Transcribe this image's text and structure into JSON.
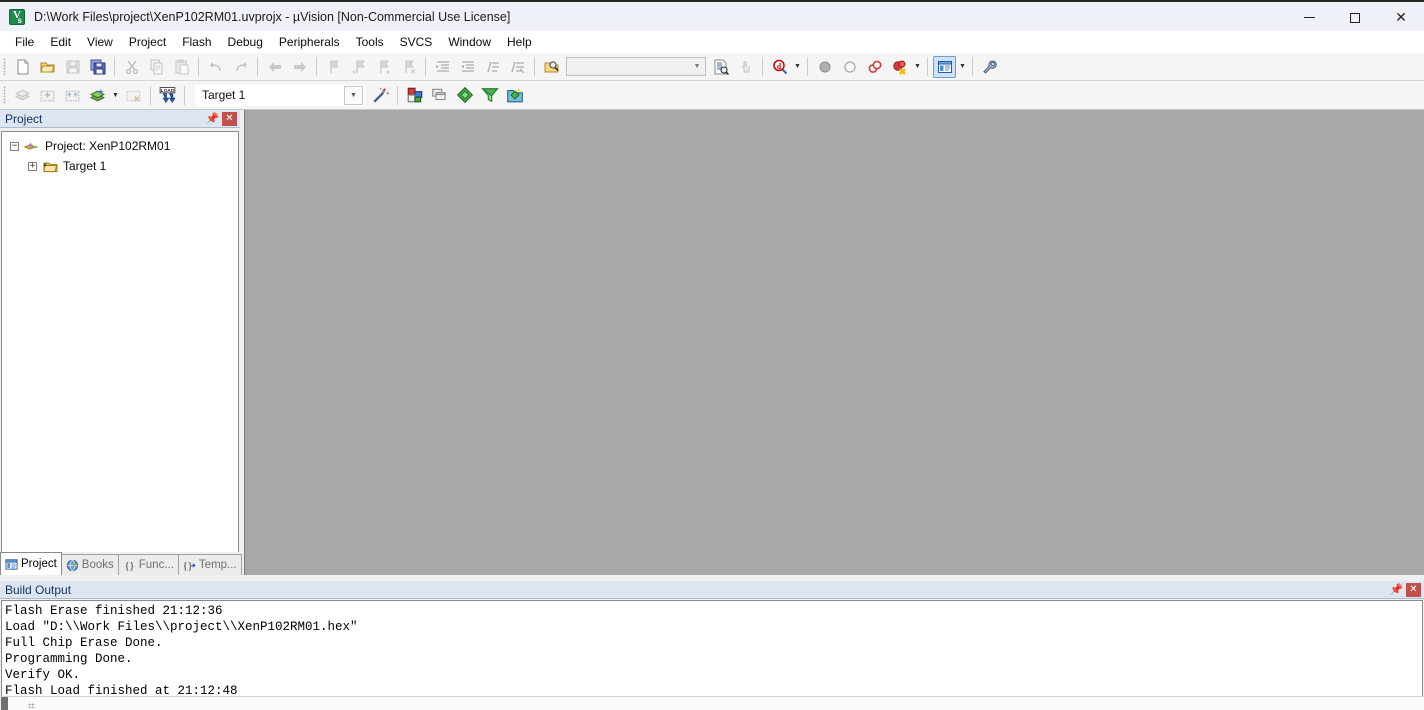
{
  "window": {
    "title": "D:\\Work Files\\project\\XenP102RM01.uvprojx - µVision  [Non-Commercial Use License]",
    "app_icon": "uvision-icon",
    "controls": {
      "minimize": "minimize-icon",
      "maximize": "maximize-icon",
      "close": "close-icon"
    }
  },
  "menubar": {
    "items": [
      {
        "label": "File"
      },
      {
        "label": "Edit"
      },
      {
        "label": "View"
      },
      {
        "label": "Project"
      },
      {
        "label": "Flash"
      },
      {
        "label": "Debug"
      },
      {
        "label": "Peripherals"
      },
      {
        "label": "Tools"
      },
      {
        "label": "SVCS"
      },
      {
        "label": "Window"
      },
      {
        "label": "Help"
      }
    ]
  },
  "toolbar_file": {
    "buttons": [
      {
        "name": "new-file-button",
        "icon": "new-file-icon",
        "enabled": true
      },
      {
        "name": "open-file-button",
        "icon": "open-folder-icon",
        "enabled": true
      },
      {
        "name": "save-button",
        "icon": "floppy-save-icon",
        "enabled": false
      },
      {
        "name": "save-all-button",
        "icon": "save-all-icon",
        "enabled": true
      },
      {
        "name": "cut-button",
        "icon": "scissors-icon",
        "enabled": false
      },
      {
        "name": "copy-button",
        "icon": "copy-icon",
        "enabled": false
      },
      {
        "name": "paste-button",
        "icon": "paste-icon",
        "enabled": false
      },
      {
        "name": "undo-button",
        "icon": "undo-arrow-icon",
        "enabled": false
      },
      {
        "name": "redo-button",
        "icon": "redo-arrow-icon",
        "enabled": false
      },
      {
        "name": "navigate-back-button",
        "icon": "arrow-left-icon",
        "enabled": false
      },
      {
        "name": "navigate-forward-button",
        "icon": "arrow-right-icon",
        "enabled": false
      },
      {
        "name": "toggle-bookmark-button",
        "icon": "bookmark-icon",
        "enabled": false
      },
      {
        "name": "previous-bookmark-button",
        "icon": "bookmark-prev-icon",
        "enabled": false
      },
      {
        "name": "next-bookmark-button",
        "icon": "bookmark-next-icon",
        "enabled": false
      },
      {
        "name": "clear-bookmarks-button",
        "icon": "bookmark-clear-icon",
        "enabled": false
      },
      {
        "name": "indent-button",
        "icon": "indent-right-icon",
        "enabled": false
      },
      {
        "name": "outdent-button",
        "icon": "indent-left-icon",
        "enabled": false
      },
      {
        "name": "comment-button",
        "icon": "comment-lines-icon",
        "enabled": false
      },
      {
        "name": "uncomment-button",
        "icon": "uncomment-lines-icon",
        "enabled": false
      },
      {
        "name": "find-in-files-button",
        "icon": "find-in-files-icon",
        "enabled": true
      },
      {
        "name": "bookmark-list-button",
        "icon": "document-search-icon",
        "enabled": true
      },
      {
        "name": "jump-back-button",
        "icon": "hand-pointer-icon",
        "enabled": false
      },
      {
        "name": "insert-debug-button",
        "icon": "red-d-magnifier-icon",
        "enabled": true
      },
      {
        "name": "insert-breakpoint-button",
        "icon": "grey-filled-circle-icon",
        "enabled": false
      },
      {
        "name": "remove-breakpoint-button",
        "icon": "grey-hollow-circle-icon",
        "enabled": false
      },
      {
        "name": "disable-all-breakpoints-button",
        "icon": "red-rings-icon",
        "enabled": true
      },
      {
        "name": "kill-all-breakpoints-button",
        "icon": "red-circle-x-icon",
        "enabled": true
      },
      {
        "name": "window-list-button",
        "icon": "window-panel-icon",
        "enabled": true,
        "active": true
      },
      {
        "name": "configuration-button",
        "icon": "wrench-icon",
        "enabled": true
      }
    ],
    "search": {
      "value": "",
      "placeholder": ""
    }
  },
  "toolbar_build": {
    "buttons": [
      {
        "name": "translate-file-button",
        "icon": "translate-stack-icon",
        "enabled": false
      },
      {
        "name": "build-target-button",
        "icon": "build-target-icon",
        "enabled": false
      },
      {
        "name": "rebuild-all-button",
        "icon": "rebuild-all-icon",
        "enabled": false
      },
      {
        "name": "batch-build-button",
        "icon": "batch-build-icon",
        "enabled": true
      },
      {
        "name": "stop-build-button",
        "icon": "stop-build-icon",
        "enabled": false
      },
      {
        "name": "download-button",
        "icon": "load-download-icon",
        "label": "LOAD",
        "enabled": true
      },
      {
        "name": "target-options-button",
        "icon": "magic-wand-icon",
        "enabled": true
      },
      {
        "name": "manage-project-items-button",
        "icon": "manage-components-icon",
        "enabled": true
      },
      {
        "name": "manage-multi-project-button",
        "icon": "multi-project-icon",
        "enabled": true
      },
      {
        "name": "pack-installer-button",
        "icon": "green-diamond-icon",
        "enabled": true
      },
      {
        "name": "manage-run-time-env-button",
        "icon": "green-funnel-icon",
        "enabled": true
      },
      {
        "name": "select-software-packs-button",
        "icon": "software-packs-icon",
        "enabled": true
      }
    ],
    "target_select": {
      "value": "Target 1",
      "caret": "chevron-down-icon"
    }
  },
  "project_panel": {
    "header": {
      "title": "Project",
      "pin": "pin-icon",
      "close": "close-icon"
    },
    "tree": [
      {
        "label": "Project: XenP102RM01",
        "level": 1,
        "expander": "−",
        "icon": "project-icon"
      },
      {
        "label": "Target 1",
        "level": 2,
        "expander": "+",
        "icon": "target-folder-icon"
      }
    ],
    "tabs": [
      {
        "label": "Project",
        "icon": "project-tab-icon",
        "active": true
      },
      {
        "label": "Books",
        "icon": "books-tab-icon",
        "active": false
      },
      {
        "label": "Func...",
        "icon": "functions-tab-icon",
        "active": false
      },
      {
        "label": "Temp...",
        "icon": "templates-tab-icon",
        "active": false
      }
    ]
  },
  "build_output": {
    "header": {
      "title": "Build Output",
      "pin": "pin-icon",
      "close": "close-icon"
    },
    "lines": [
      "Flash Erase finished 21:12:36",
      "Load \"D:\\\\Work Files\\\\project\\\\XenP102RM01.hex\"",
      "Full Chip Erase Done.",
      "Programming Done.",
      "Verify OK.",
      "Flash Load finished at 21:12:48"
    ]
  },
  "colors": {
    "titlebar_bg": "#eef1f7",
    "panel_header_bg": "#dde6f0",
    "panel_header_text": "#12305c",
    "mdi_bg": "#a8a8a8",
    "close_button_red": "#c0504d",
    "toolbar_bg": "#f5f5f5",
    "active_button_bg": "#cde3fa"
  }
}
